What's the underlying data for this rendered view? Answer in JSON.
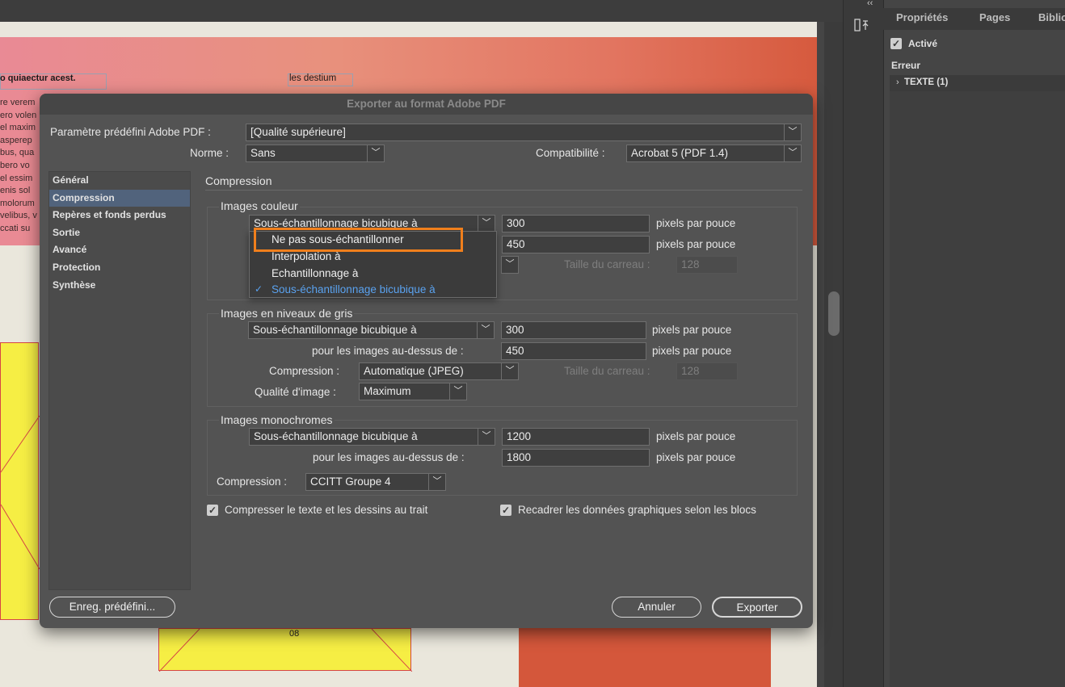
{
  "document": {
    "frame_text_1": "o quiaectur acest.",
    "frame_text_2": "les destium",
    "body_lines": [
      "re verem",
      "ero volen",
      "el maxim",
      "asperep",
      "bus, qua",
      "bero vo",
      "el essim",
      "enis sol",
      "molorum",
      "velibus, v",
      "ccati su"
    ],
    "page_number": "08"
  },
  "right_panel": {
    "collapse_label": "‹‹",
    "tabs": [
      "Propriétés",
      "Pages",
      "Biblio"
    ],
    "active_label": "Activé",
    "error_heading": "Erreur",
    "error_item": "TEXTE (1)"
  },
  "dialog": {
    "title": "Exporter au format Adobe PDF",
    "preset_label": "Paramètre prédéfini Adobe PDF :",
    "preset_value": "[Qualité supérieure]",
    "norme_label": "Norme :",
    "norme_value": "Sans",
    "compat_label": "Compatibilité :",
    "compat_value": "Acrobat 5 (PDF 1.4)",
    "sidebar": [
      "Général",
      "Compression",
      "Repères et fonds perdus",
      "Sortie",
      "Avancé",
      "Protection",
      "Synthèse"
    ],
    "selected_sidebar": "Compression",
    "section_title": "Compression",
    "color": {
      "title": "Images couleur",
      "sampling": "Sous-échantillonnage bicubique à",
      "ppi": "300",
      "above_ppi": "450",
      "unit": "pixels par pouce",
      "tile_label": "Taille du carreau :",
      "tile_value": "128"
    },
    "gray": {
      "title": "Images en niveaux de gris",
      "sampling": "Sous-échantillonnage bicubique à",
      "ppi": "300",
      "above_label": "pour les images au-dessus de :",
      "above_ppi": "450",
      "unit": "pixels par pouce",
      "compression_label": "Compression :",
      "compression_value": "Automatique (JPEG)",
      "tile_label": "Taille du carreau :",
      "tile_value": "128",
      "quality_label": "Qualité d'image :",
      "quality_value": "Maximum"
    },
    "mono": {
      "title": "Images monochromes",
      "sampling": "Sous-échantillonnage bicubique à",
      "ppi": "1200",
      "above_label": "pour les images au-dessus de :",
      "above_ppi": "1800",
      "unit": "pixels par pouce",
      "compression_label": "Compression :",
      "compression_value": "CCITT Groupe 4"
    },
    "compress_text": {
      "label": "Compresser le texte et les dessins au trait",
      "checked": true
    },
    "crop_data": {
      "label": "Recadrer les données graphiques selon les blocs",
      "checked": true
    },
    "save_preset_button": "Enreg. prédéfini...",
    "cancel_button": "Annuler",
    "export_button": "Exporter"
  },
  "popup_menu": {
    "items": [
      "Ne pas sous-échantillonner",
      "Interpolation à",
      "Echantillonnage à",
      "Sous-échantillonnage bicubique à"
    ],
    "checked_index": 3,
    "checked_color": "#5aa2ef",
    "highlight_color": "#f07f1c"
  }
}
